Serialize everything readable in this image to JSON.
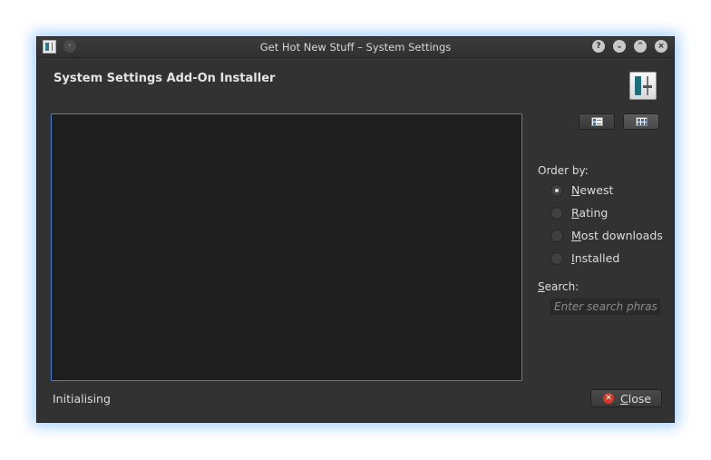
{
  "window": {
    "title": "Get Hot New Stuff – System Settings",
    "controls": {
      "help": "?",
      "minimize": "⌄",
      "maximize": "⌃",
      "close": "×",
      "menu": "·"
    }
  },
  "header": {
    "title": "System Settings Add-On Installer"
  },
  "view_modes": [
    {
      "name": "details-view",
      "active": false
    },
    {
      "name": "icons-view",
      "active": true
    }
  ],
  "order_by": {
    "label": "Order by:",
    "options": [
      {
        "accel": "N",
        "rest": "ewest",
        "checked": true
      },
      {
        "accel": "R",
        "rest": "ating",
        "checked": false
      },
      {
        "accel": "M",
        "rest": "ost downloads",
        "checked": false
      },
      {
        "accel": "I",
        "rest": "nstalled",
        "checked": false
      }
    ]
  },
  "search": {
    "label_accel": "S",
    "label_rest": "earch:",
    "placeholder": "Enter search phrase",
    "value": ""
  },
  "status": {
    "text": "Initialising"
  },
  "footer": {
    "close_accel": "C",
    "close_rest": "lose"
  },
  "colors": {
    "window_bg": "#323232",
    "content_bg": "#1e1e1e",
    "focus_border": "#3f7fd4",
    "glow": "#5aaaff",
    "close_icon": "#d23a2a"
  }
}
